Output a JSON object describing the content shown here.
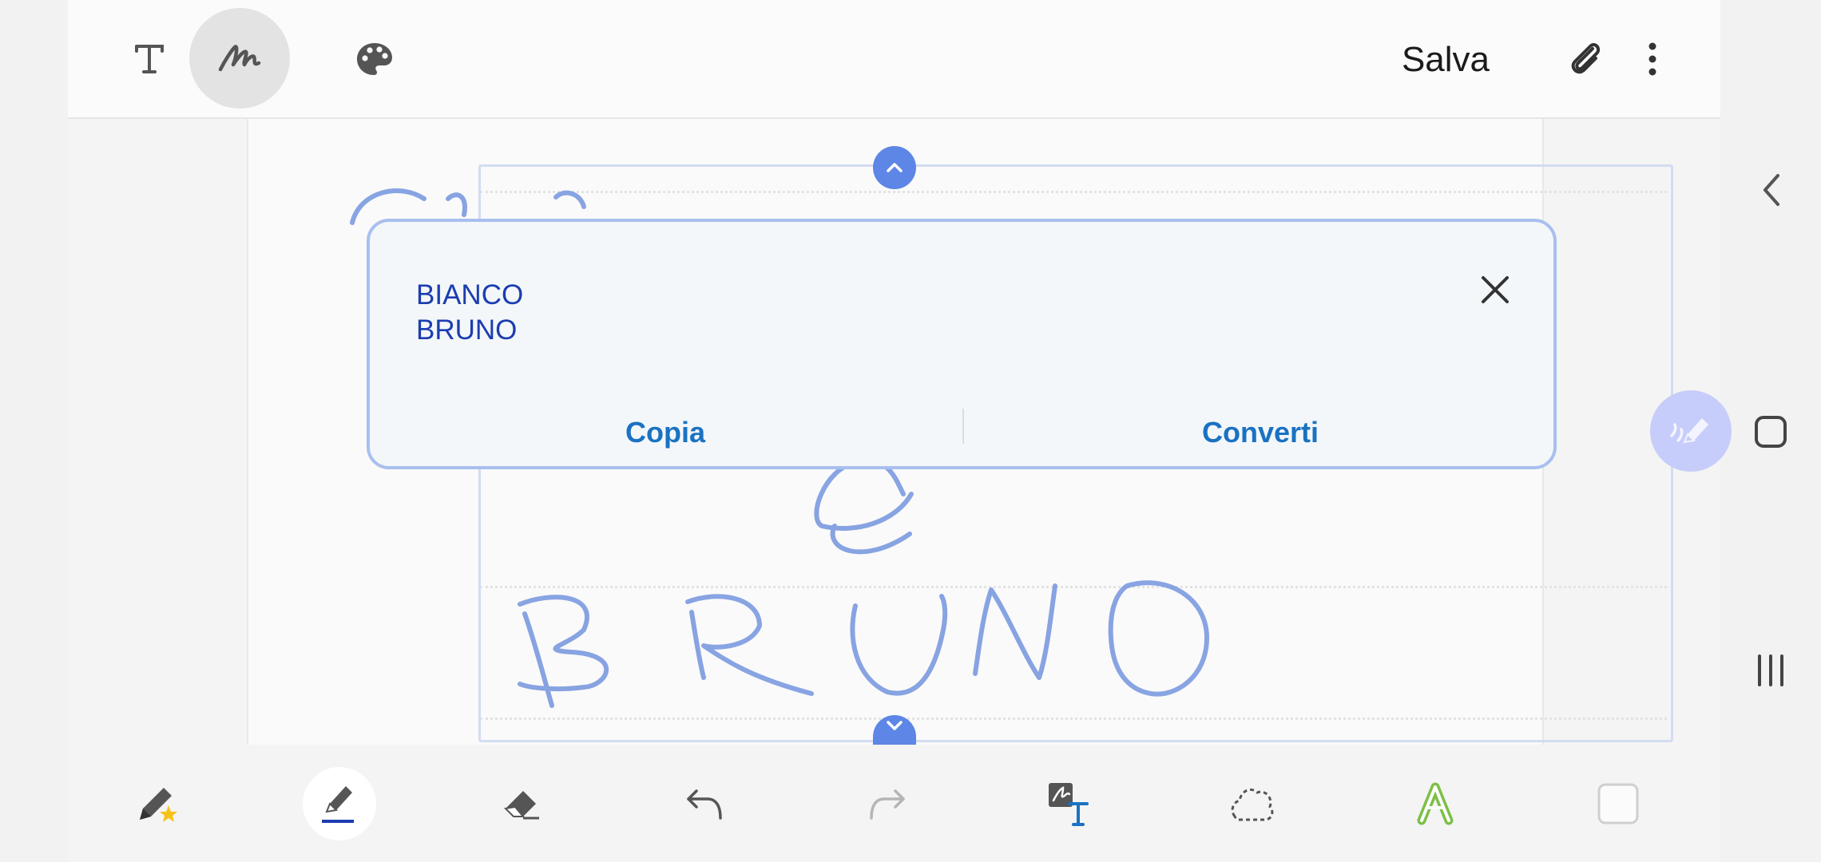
{
  "toolbar": {
    "save_label": "Salva",
    "icons": [
      "text-icon",
      "handwriting-icon",
      "palette-icon",
      "paperclip-icon",
      "more-vertical-icon"
    ]
  },
  "recognition_popup": {
    "lines": [
      "BIANCO",
      "BRUNO"
    ],
    "copy_label": "Copia",
    "convert_label": "Converti"
  },
  "bottom_toolbar": {
    "icons": [
      "favorite-pen-icon",
      "pen-icon",
      "eraser-icon",
      "undo-icon",
      "redo-icon",
      "handwriting-to-text-icon",
      "lasso-icon",
      "text-style-icon",
      "color-swatch-icon"
    ]
  },
  "colors": {
    "accent": "#5d86e6",
    "ink": "#7b9ae0",
    "action_text": "#1a72c2",
    "recognized_text": "#1c3db0",
    "fab": "#c6cdfa"
  }
}
